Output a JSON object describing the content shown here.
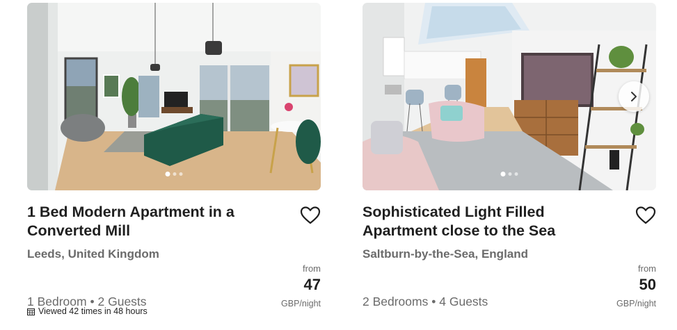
{
  "listings": [
    {
      "title_line1": "1 Bed Modern Apartment in a",
      "title_line2": "Converted Mill",
      "location": "Leeds, United Kingdom",
      "price_prefix": "from",
      "price": "47",
      "price_unit": "GBP/night",
      "bedrooms": "1 Bedroom",
      "guests": "2 Guests",
      "separator": "•",
      "viewed_text": "Viewed 42 times in 48 hours",
      "carousel": {
        "images": 3,
        "active": 1
      },
      "favourite": false,
      "icons": {
        "favourite": "heart-outline-icon",
        "viewed": "calendar-grid-icon"
      }
    },
    {
      "title_line1": "Sophisticated Light Filled",
      "title_line2": "Apartment close to the Sea",
      "location": "Saltburn-by-the-Sea, England",
      "price_prefix": "from",
      "price": "50",
      "price_unit": "GBP/night",
      "bedrooms": "2 Bedrooms",
      "guests": "4 Guests",
      "separator": "•",
      "carousel": {
        "images": 3,
        "active": 1
      },
      "favourite": false,
      "icons": {
        "favourite": "heart-outline-icon",
        "next": "chevron-right-icon"
      }
    }
  ],
  "colors": {
    "title": "#1f1f1f",
    "secondary_text": "#6b6b6b",
    "wall": "#eef0ef",
    "floor": "#d8b58a",
    "sofa_green": "#1f5a48",
    "pink_sofa": "#e8c8c8"
  }
}
